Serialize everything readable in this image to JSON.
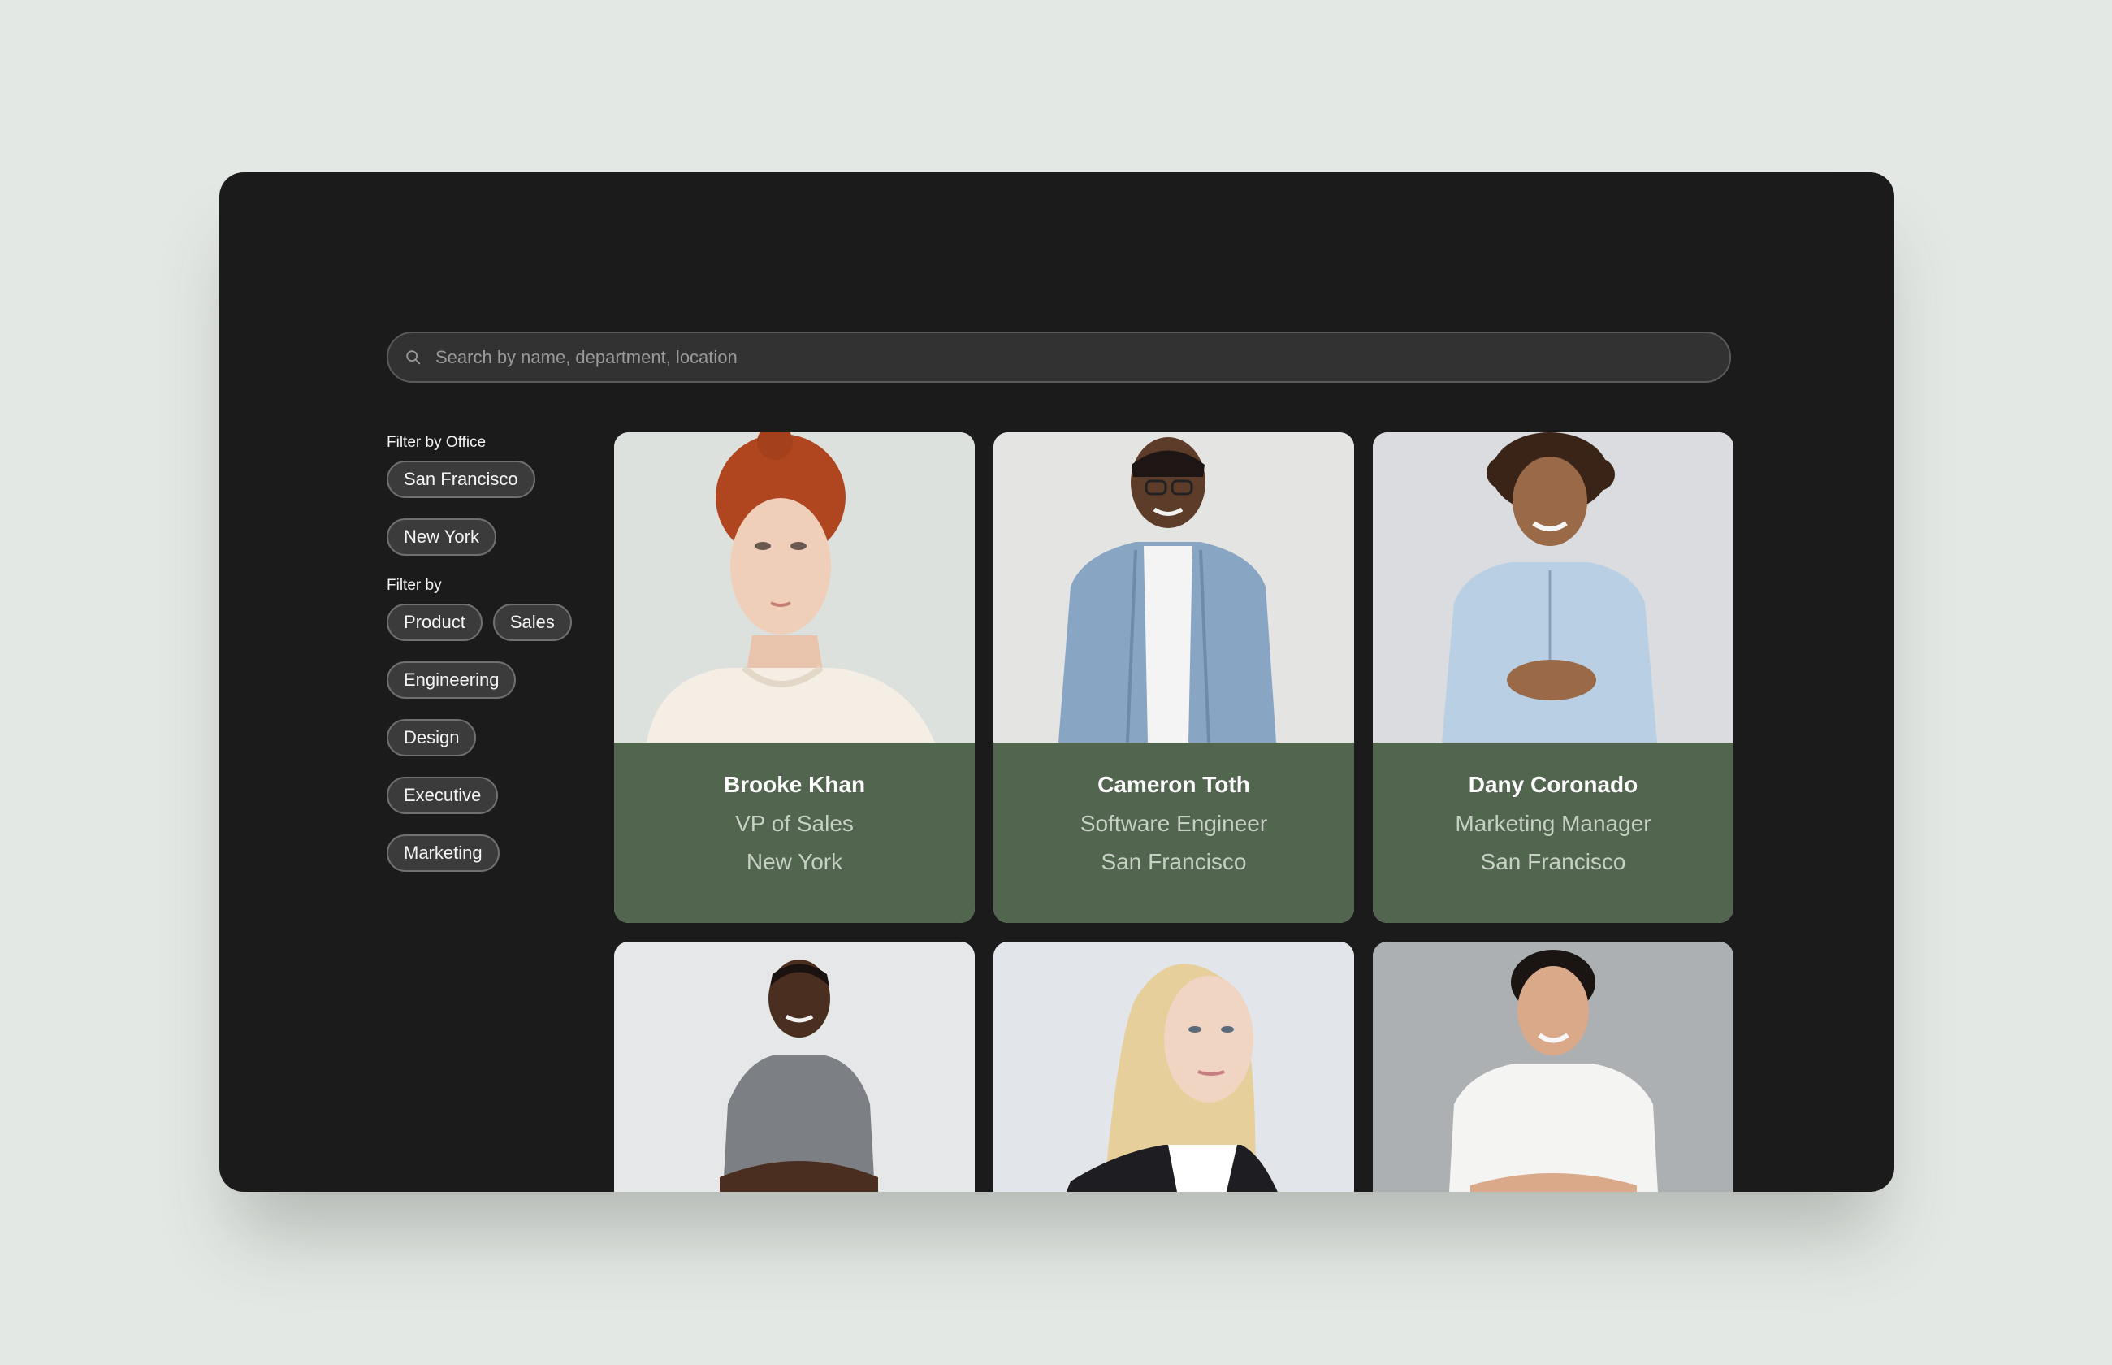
{
  "search": {
    "placeholder": "Search by name, department, location"
  },
  "filters": {
    "office_title": "Filter by Office",
    "offices": [
      "San Francisco",
      "New York"
    ],
    "department_title": "Filter by",
    "departments": [
      "Product",
      "Sales",
      "Engineering",
      "Design",
      "Executive",
      "Marketing"
    ]
  },
  "people": [
    {
      "name": "Brooke Khan",
      "role": "VP of Sales",
      "office": "New York"
    },
    {
      "name": "Cameron Toth",
      "role": "Software Engineer",
      "office": "San Francisco"
    },
    {
      "name": "Dany Coronado",
      "role": "Marketing Manager",
      "office": "San Francisco"
    },
    {
      "name": "",
      "role": "",
      "office": ""
    },
    {
      "name": "",
      "role": "",
      "office": ""
    },
    {
      "name": "",
      "role": "",
      "office": ""
    }
  ],
  "colors": {
    "page_bg": "#e4e8e4",
    "window_bg": "#1b1b1b",
    "card_info_bg": "#52654f"
  },
  "icons": {
    "search": "search-icon"
  }
}
